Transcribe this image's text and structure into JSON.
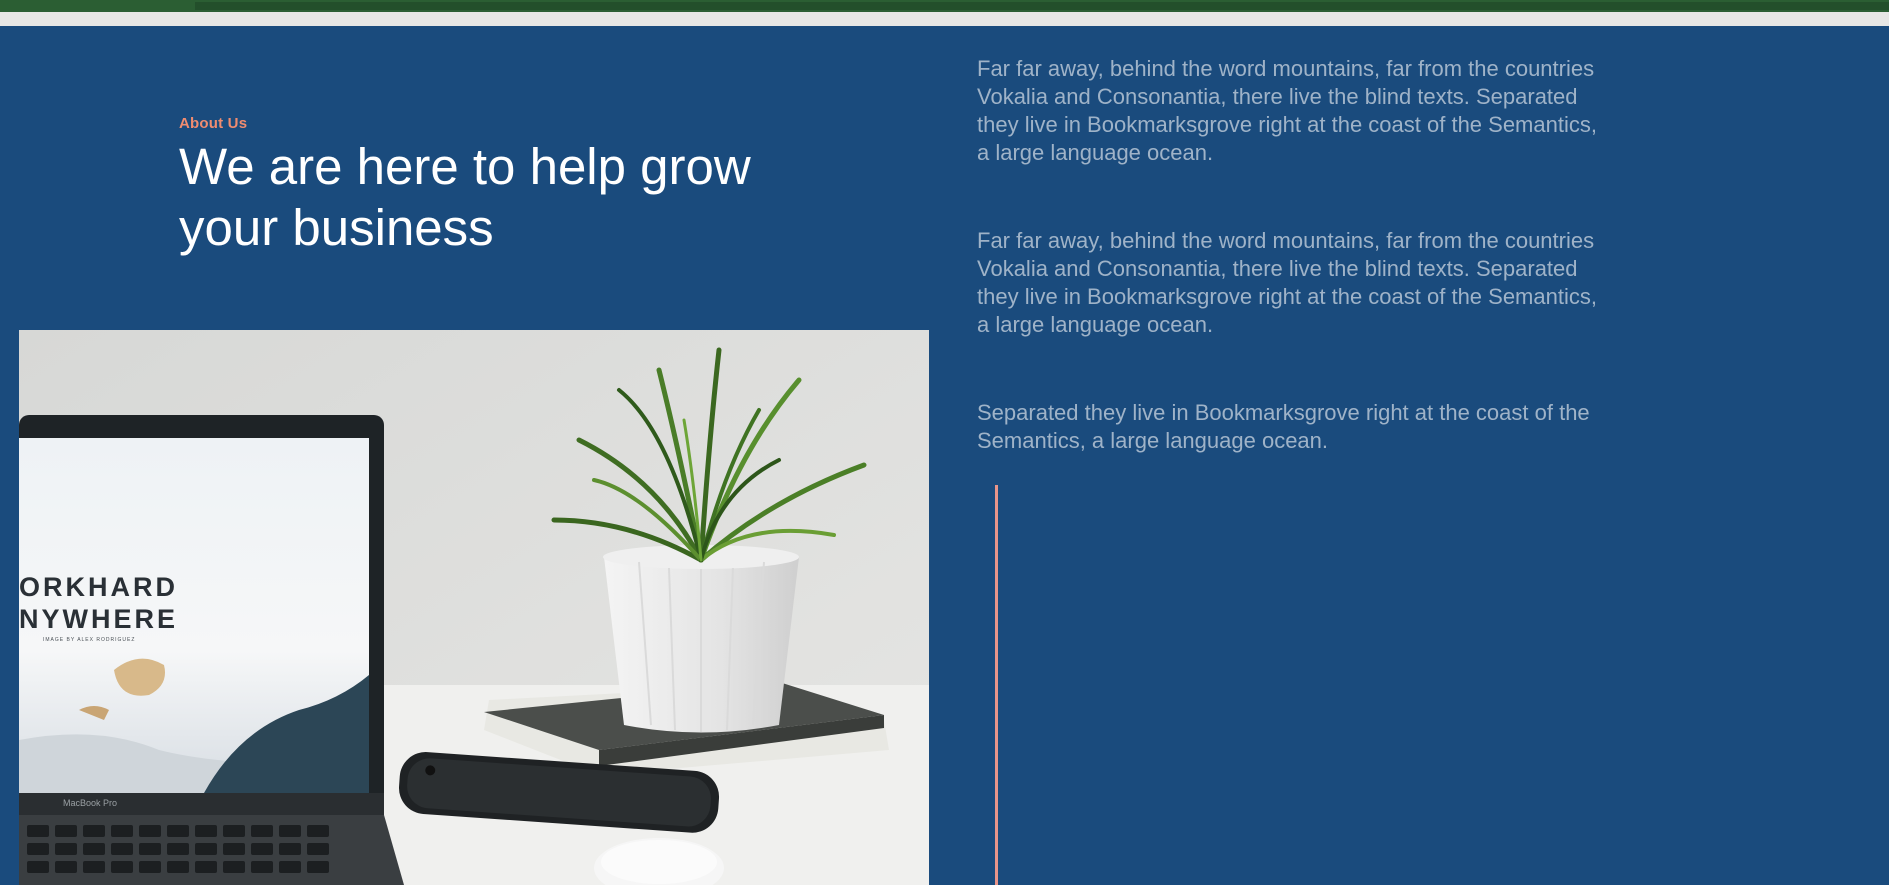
{
  "about": {
    "kicker": "About Us",
    "heading": "We are here to help grow your business"
  },
  "copy": {
    "p1": "Far far away, behind the word mountains, far from the countries Vokalia and Consonantia, there live the blind texts. Separated they live in Bookmarksgrove right at the coast of the Semantics, a large language ocean.",
    "p2": "Far far away, behind the word mountains, far from the countries Vokalia and Consonantia, there live the blind texts. Separated they live in Bookmarksgrove right at the coast of the Semantics, a large language ocean.",
    "p3": "Separated they live in Bookmarksgrove right at the coast of the Semantics, a large language ocean."
  },
  "photo": {
    "screen_line1": "ORKHARD",
    "screen_line2": "NYWHERE",
    "screen_caption": "IMAGE BY ALEX RODRIGUEZ",
    "laptop_model": "MacBook Pro"
  },
  "colors": {
    "section_bg": "#1a4b7d",
    "accent": "#f08c70",
    "topbar": "#2b5e33",
    "body_text": "#9fb3c8"
  }
}
